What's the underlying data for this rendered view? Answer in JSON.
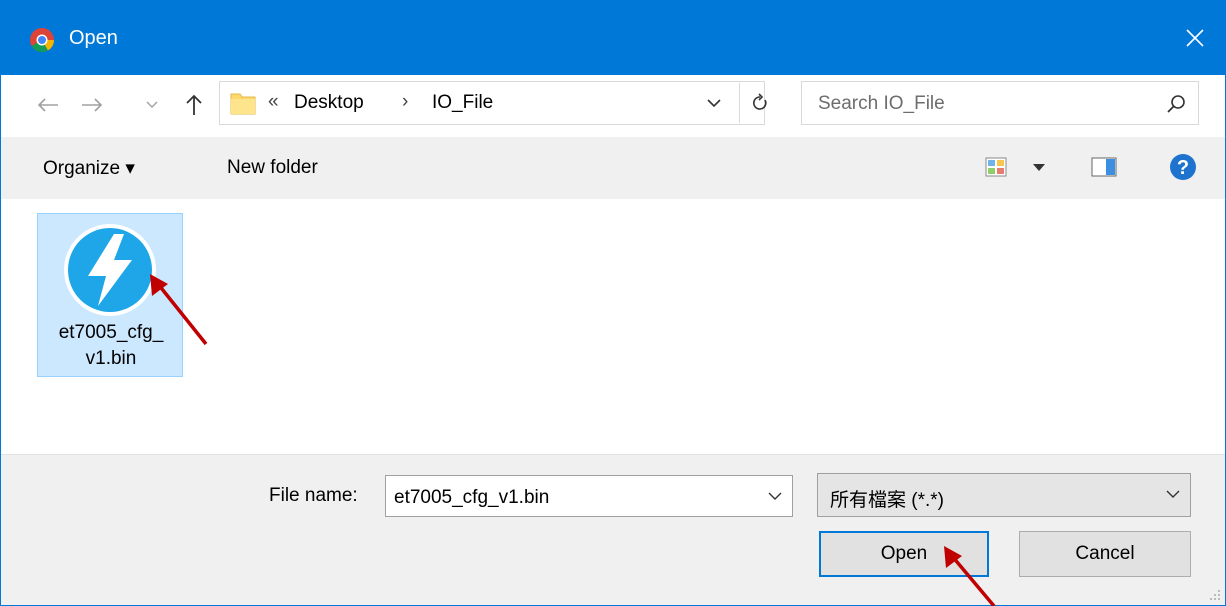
{
  "window": {
    "title": "Open",
    "accent_color": "#0078d7"
  },
  "navigation": {
    "back_icon": "back-arrow-icon",
    "forward_icon": "forward-arrow-icon",
    "recent_icon": "chevron-down-icon",
    "up_icon": "up-arrow-icon"
  },
  "address": {
    "overflow": "«",
    "crumbs": [
      "Desktop",
      "IO_File"
    ],
    "separator": "›"
  },
  "search": {
    "placeholder": "Search IO_File"
  },
  "toolbar": {
    "organize_label": "Organize ▾",
    "new_folder_label": "New folder"
  },
  "files": [
    {
      "name": "et7005_cfg_v1.bin",
      "display_name": "et7005_cfg_\nv1.bin",
      "selected": true,
      "icon": "lightning-bolt-icon"
    }
  ],
  "footer": {
    "file_name_label": "File name:",
    "file_name_value": "et7005_cfg_v1.bin",
    "file_type_value": "所有檔案 (*.*)",
    "open_label": "Open",
    "cancel_label": "Cancel"
  }
}
